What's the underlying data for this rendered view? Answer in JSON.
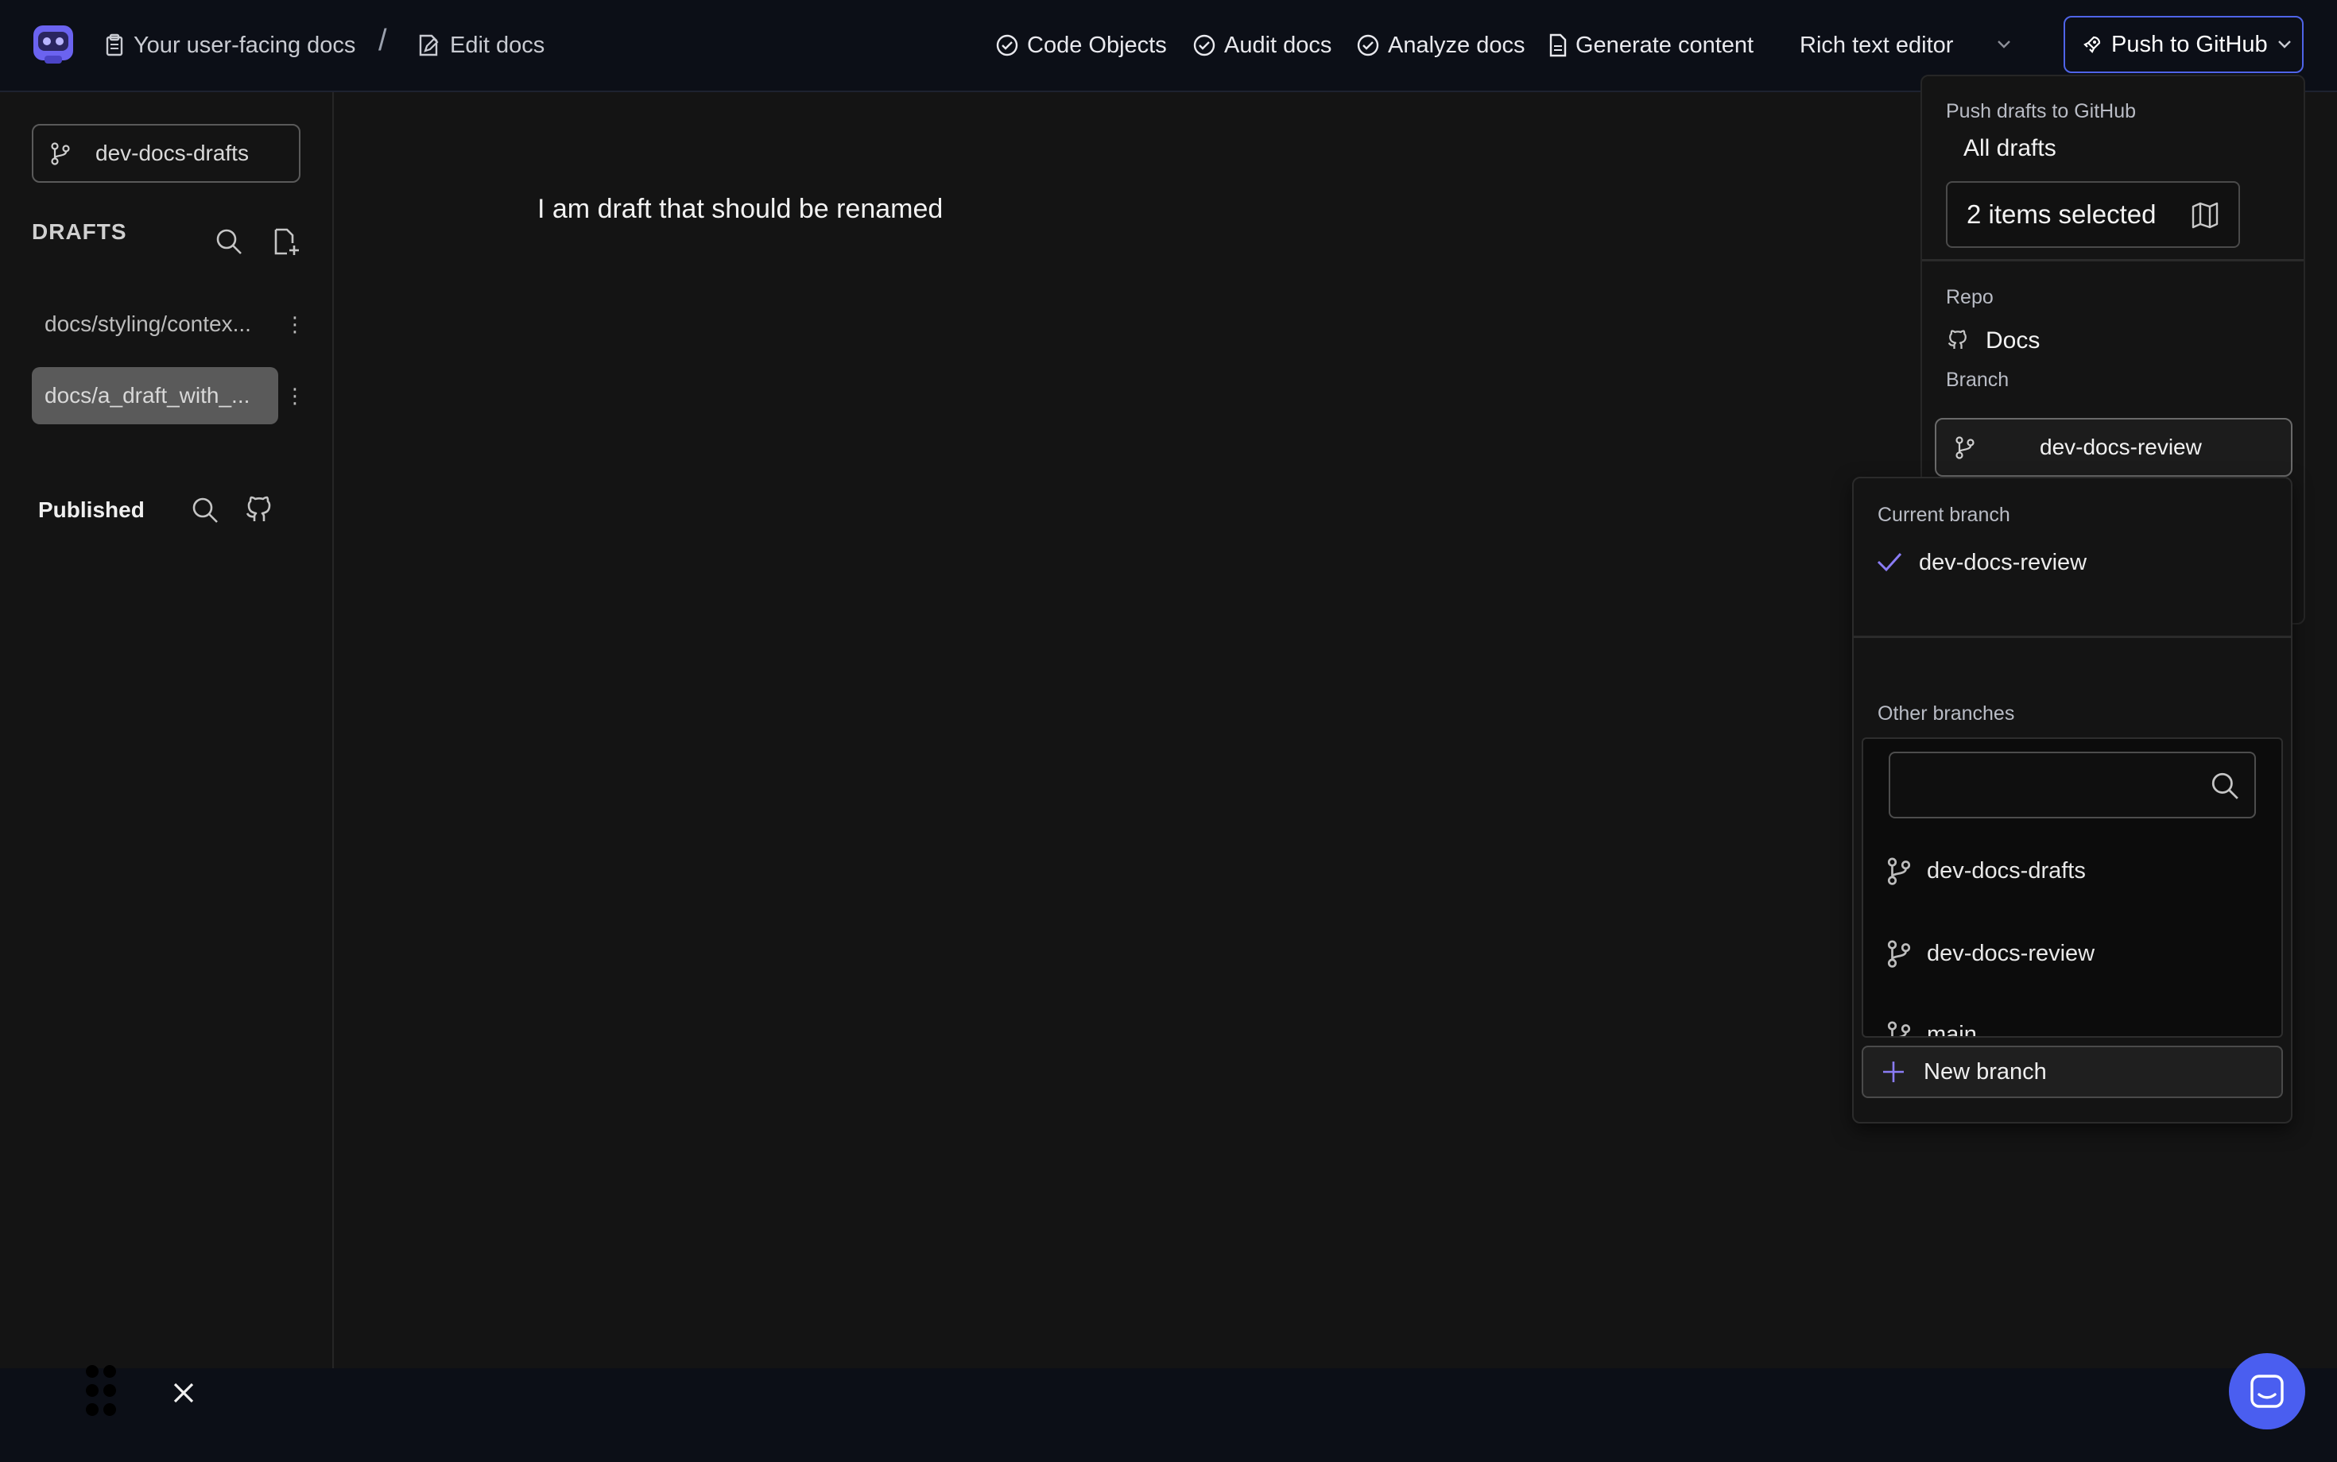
{
  "header": {
    "breadcrumb": [
      "Your user-facing docs",
      "Edit docs"
    ],
    "separator": "/",
    "nav": [
      "Code Objects",
      "Audit docs",
      "Analyze docs",
      "Generate content"
    ],
    "editor_mode": "Rich text editor",
    "push_button": "Push to GitHub"
  },
  "sidebar": {
    "current_branch": "dev-docs-drafts",
    "drafts_title": "DRAFTS",
    "drafts": [
      "docs/styling/contex...",
      "docs/a_draft_with_..."
    ],
    "published_title": "Published"
  },
  "editor": {
    "text": "I am draft that should be renamed"
  },
  "push_panel": {
    "title": "Push drafts to GitHub",
    "scope": "All drafts",
    "selection": "2 items selected",
    "repo_label": "Repo",
    "repo_name": "Docs",
    "branch_label": "Branch",
    "branch_value": "dev-docs-review"
  },
  "branch_dropdown": {
    "current_label": "Current branch",
    "current_branch": "dev-docs-review",
    "other_label": "Other branches",
    "search_value": "",
    "branches": [
      "dev-docs-drafts",
      "dev-docs-review",
      "main"
    ],
    "new_branch": "New branch"
  },
  "colors": {
    "accent": "#4f64e8",
    "background": "#141414",
    "topbar": "#0c0f17",
    "check": "#8a7cf5"
  }
}
